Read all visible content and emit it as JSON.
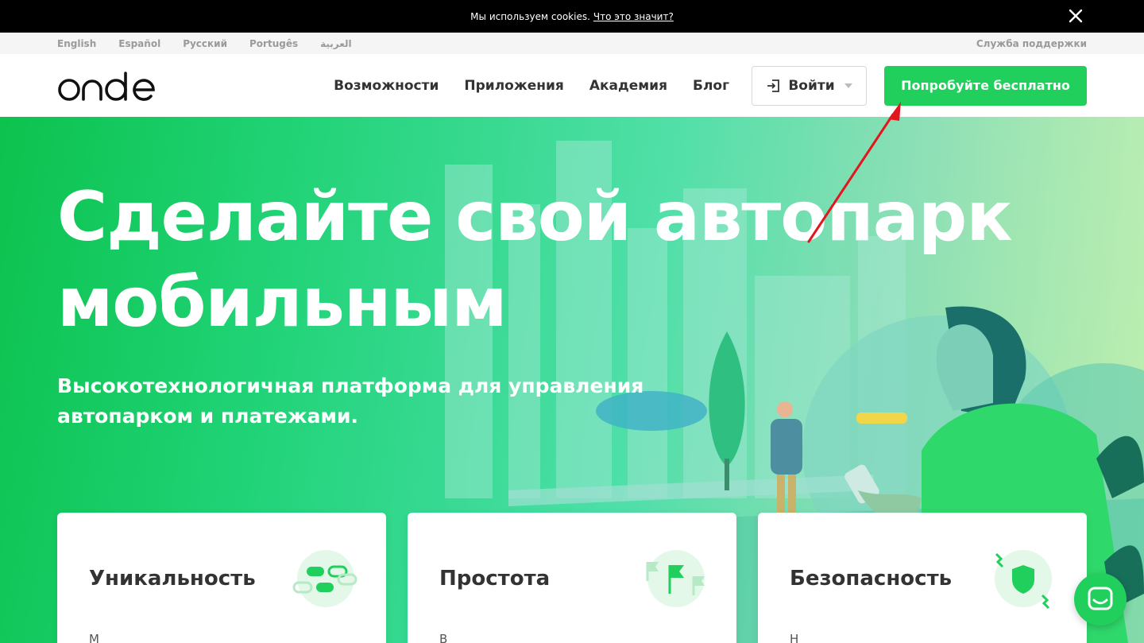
{
  "cookie_bar": {
    "text": "Мы используем cookies.",
    "link": "Что это значит?"
  },
  "lang_bar": {
    "languages": [
      "English",
      "Español",
      "Русский",
      "Portugês",
      "العربية"
    ],
    "support": "Служба поддержки"
  },
  "header": {
    "logo": "onde",
    "nav": [
      "Возможности",
      "Приложения",
      "Академия",
      "Блог"
    ],
    "login_label": "Войти",
    "try_label": "Попробуйте бесплатно"
  },
  "hero": {
    "title_line1": "Сделайте свой автопарк",
    "title_line2": "мобильным",
    "subtitle_line1": "Высокотехнологичная платформа для управления",
    "subtitle_line2": "автопарком и платежами."
  },
  "cards": [
    {
      "title": "Уникальность",
      "text": "М"
    },
    {
      "title": "Простота",
      "text": "В"
    },
    {
      "title": "Безопасность",
      "text": "Н"
    }
  ],
  "colors": {
    "accent": "#21cf5c",
    "annotation_arrow": "#e3151d"
  },
  "icons": {
    "cookie_close": "close-icon",
    "login": "login-icon",
    "chat": "chat-icon"
  }
}
